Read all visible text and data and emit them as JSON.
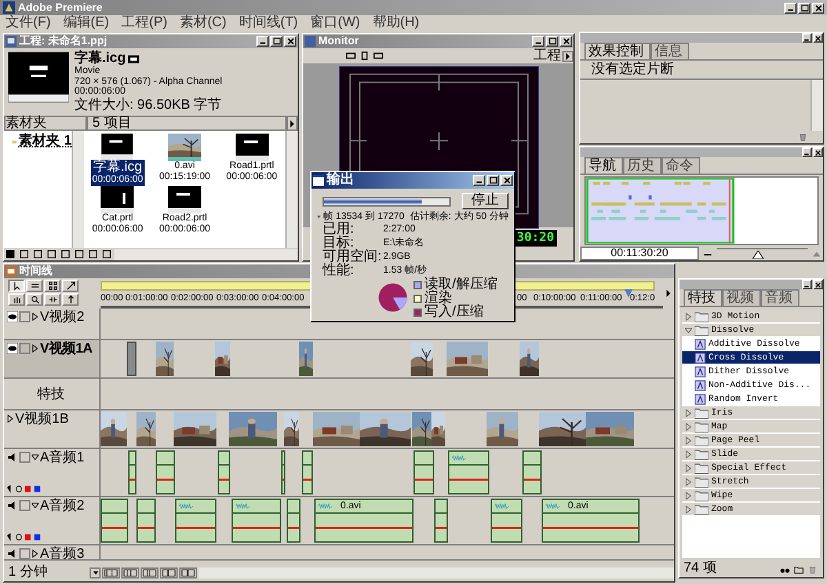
{
  "app": {
    "title": "Adobe Premiere"
  },
  "menu": [
    "文件(F)",
    "编辑(E)",
    "工程(P)",
    "素材(C)",
    "时间线(T)",
    "窗口(W)",
    "帮助(H)"
  ],
  "project": {
    "title": "工程: 未命名1.ppj",
    "preview": {
      "name": "字幕.icg",
      "type": "Movie",
      "format": "720 × 576 (1.067) - Alpha Channel",
      "duration": "00:00:06:00",
      "size": "文件大小: 96.50KB 字节"
    },
    "bins_header": "素材夹",
    "items_header": "5 项目",
    "bins": [
      {
        "label": "素材夹 1",
        "selected": true
      }
    ],
    "items": [
      {
        "name": "字幕.icg",
        "duration": "00:00:06:00",
        "kind": "title",
        "selected": true
      },
      {
        "name": "0.avi",
        "duration": "00:15:19:00",
        "kind": "video",
        "selected": false
      },
      {
        "name": "Road1.prtl",
        "duration": "00:00:06:00",
        "kind": "title",
        "selected": false
      },
      {
        "name": "Cat.prtl",
        "duration": "00:00:06:00",
        "kind": "title",
        "selected": false
      },
      {
        "name": "Road2.prtl",
        "duration": "00:00:06:00",
        "kind": "title",
        "selected": false
      }
    ]
  },
  "monitor": {
    "title": "Monitor",
    "view": "工程",
    "timecode": "30:20"
  },
  "effect_controls": {
    "tabs": [
      {
        "label": "效果控制",
        "selected": true
      },
      {
        "label": "信息",
        "selected": false
      }
    ],
    "message": "没有选定片断"
  },
  "navigator": {
    "tabs": [
      {
        "label": "导航",
        "selected": true
      },
      {
        "label": "历史",
        "selected": false
      },
      {
        "label": "命令",
        "selected": false
      }
    ],
    "timecode": "00:11:30:20",
    "zoom": {
      "level": 0.45
    }
  },
  "timeline": {
    "title": "时间线",
    "ruler": [
      "00:00",
      "0:01:00:00",
      "0:02:00:00",
      "0:03:00:00",
      "0:04:00:00",
      "00",
      "0:10:00:00",
      "0:11:00:00",
      "0:12:0"
    ],
    "tracks": [
      {
        "name": "V视频2",
        "kind": "video",
        "expanded": false
      },
      {
        "name": "V视频1A",
        "kind": "video",
        "expanded": false
      },
      {
        "name": "特技",
        "kind": "transition"
      },
      {
        "name": "V视频1B",
        "kind": "video",
        "expanded": false
      },
      {
        "name": "A音频1",
        "kind": "audio",
        "expanded": true
      },
      {
        "name": "A音频2",
        "kind": "audio",
        "expanded": true,
        "clip_labels": [
          "0.avi",
          "0.avi"
        ]
      },
      {
        "name": "A音频3",
        "kind": "audio",
        "expanded": false
      }
    ],
    "zoom": "1 分钟"
  },
  "transitions": {
    "tabs": [
      {
        "label": "特技",
        "selected": true
      },
      {
        "label": "视频",
        "selected": false
      },
      {
        "label": "音频",
        "selected": false
      }
    ],
    "items": [
      {
        "label": "3D Motion",
        "expanded": false,
        "selected": false
      },
      {
        "label": "Dissolve",
        "expanded": true,
        "selected": false,
        "children": [
          {
            "label": "Additive Dissolve",
            "selected": false
          },
          {
            "label": "Cross Dissolve",
            "selected": true
          },
          {
            "label": "Dither Dissolve",
            "selected": false
          },
          {
            "label": "Non-Additive Dis...",
            "selected": false
          },
          {
            "label": "Random Invert",
            "selected": false
          }
        ]
      },
      {
        "label": "Iris",
        "expanded": false,
        "selected": false
      },
      {
        "label": "Map",
        "expanded": false,
        "selected": false
      },
      {
        "label": "Page Peel",
        "expanded": false,
        "selected": false
      },
      {
        "label": "Slide",
        "expanded": false,
        "selected": false
      },
      {
        "label": "Special Effect",
        "expanded": false,
        "selected": false
      },
      {
        "label": "Stretch",
        "expanded": false,
        "selected": false
      },
      {
        "label": "Wipe",
        "expanded": false,
        "selected": false
      },
      {
        "label": "Zoom",
        "expanded": false,
        "selected": false
      }
    ],
    "count": "74 项"
  },
  "output": {
    "title": "输出",
    "level": 0.78,
    "stop": "停止",
    "frames": "帧 13534 到 17270",
    "remaining": "估计剩余: 大约 50 分钟",
    "stats": [
      {
        "label": "已用:",
        "value": "2:27:00"
      },
      {
        "label": "目标:",
        "value": "E:\\未命名"
      },
      {
        "label": "可用空间:",
        "value": "2.9GB"
      },
      {
        "label": "性能:",
        "value": "1.53 帧/秒"
      }
    ],
    "legend": [
      {
        "label": "读取/解压缩",
        "color": "#a8a8ff"
      },
      {
        "label": "渲染",
        "color": "#ffffc0"
      },
      {
        "label": "写入/压缩",
        "color": "#a0205f"
      }
    ]
  }
}
